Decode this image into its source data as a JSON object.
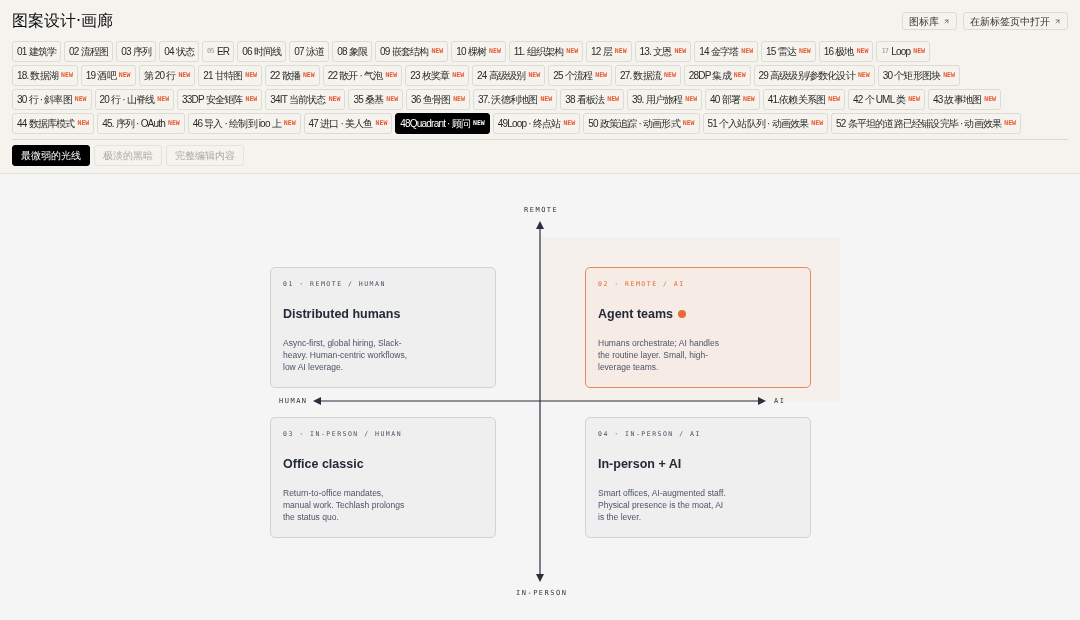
{
  "title": "图案设计·画廊",
  "header_links": [
    {
      "label": "图标库"
    },
    {
      "label": "在新标签页中打开"
    }
  ],
  "tab_rows": [
    [
      {
        "label": "01 建筑学",
        "selected": false
      },
      {
        "label": "02 流程图",
        "selected": false
      },
      {
        "label": "03 序列",
        "selected": false
      },
      {
        "label": "04 状态",
        "selected": false
      },
      {
        "prefix": "05",
        "label": "ER",
        "selected": false
      },
      {
        "label": "06 时间线",
        "selected": false
      },
      {
        "label": "07 泳道",
        "selected": false
      },
      {
        "label": "08 象限",
        "selected": false
      },
      {
        "label": "09 嵌套结构",
        "badge": "NEW",
        "selected": false
      },
      {
        "label": "10 棵树",
        "badge": "NEW",
        "selected": false
      },
      {
        "label": "11. 组织架构",
        "badge": "NEW",
        "selected": false
      },
      {
        "label": "12 层",
        "badge": "NEW",
        "selected": false
      },
      {
        "label": "13. 文恩",
        "badge": "NEW",
        "selected": false
      },
      {
        "label": "14 金字塔",
        "badge": "NEW",
        "selected": false
      },
      {
        "label": "15 雷达",
        "badge": "NEW",
        "selected": false
      },
      {
        "label": "16 极地",
        "badge": "NEW",
        "selected": false
      },
      {
        "prefix": "17",
        "label": "Loop",
        "badge": "NEW",
        "selected": false
      }
    ],
    [
      {
        "label": "18. 数据湖",
        "badge": "NEW",
        "selected": false
      },
      {
        "label": "19 酒吧",
        "badge": "NEW",
        "selected": false
      },
      {
        "label": "第 20 行",
        "badge": "NEW",
        "selected": false
      },
      {
        "label": "21 甘特图",
        "badge": "NEW",
        "selected": false
      },
      {
        "label": "22 散播",
        "badge": "NEW",
        "selected": false
      },
      {
        "label": "22 散开 · 气泡",
        "badge": "NEW",
        "selected": false
      },
      {
        "label": "23 枚奖章",
        "badge": "NEW",
        "selected": false
      },
      {
        "label": "24 高级级别",
        "badge": "NEW",
        "selected": false
      },
      {
        "label": "25 个流程",
        "badge": "NEW",
        "selected": false
      },
      {
        "label": "27. 数据流",
        "badge": "NEW",
        "selected": false
      },
      {
        "label": "28DP 集成",
        "badge": "NEW",
        "selected": false
      },
      {
        "label": "29 高级级别/参数化设计",
        "badge": "NEW",
        "selected": false
      },
      {
        "label": "30 个矩形图块",
        "badge": "NEW",
        "selected": false
      }
    ],
    [
      {
        "label": "30 行 · 斜率图",
        "badge": "NEW",
        "selected": false
      },
      {
        "label": "20 行 · 山脊线",
        "badge": "NEW",
        "selected": false
      },
      {
        "label": "33DP 安全矩阵",
        "badge": "NEW",
        "selected": false
      },
      {
        "label": "34IT 当前状态",
        "badge": "NEW",
        "selected": false
      },
      {
        "label": "35 桑基",
        "badge": "NEW",
        "selected": false
      },
      {
        "label": "36 鱼骨图",
        "badge": "NEW",
        "selected": false
      },
      {
        "label": "37. 沃德利地图",
        "badge": "NEW",
        "selected": false
      },
      {
        "label": "38 看板法",
        "badge": "NEW",
        "selected": false
      },
      {
        "label": "39. 用户旅程",
        "badge": "NEW",
        "selected": false
      },
      {
        "label": "40 部署",
        "badge": "NEW",
        "selected": false
      },
      {
        "label": "41.依赖关系图",
        "badge": "NEW",
        "selected": false
      },
      {
        "label": "42 个 UML 类",
        "badge": "NEW",
        "selected": false
      },
      {
        "label": "43 故事地图",
        "badge": "NEW",
        "selected": false
      }
    ],
    [
      {
        "label": "44 数据库模式",
        "badge": "NEW",
        "selected": false
      },
      {
        "label": "45. 序列 · OAuth",
        "badge": "NEW",
        "selected": false
      },
      {
        "label": "46 导入 · 绘制到 ioo 上",
        "badge": "NEW",
        "selected": false
      },
      {
        "label": "47 进口 · 美人鱼",
        "badge": "NEW",
        "selected": false
      },
      {
        "label": "48Quadrant · 顾问",
        "badge": "NEW",
        "selected": true
      },
      {
        "label": "49Loop · 终点站",
        "badge": "NEW",
        "selected": false
      },
      {
        "label": "50 政策追踪 · 动画形式",
        "badge": "NEW",
        "selected": false
      },
      {
        "label": "51 个入站队列 · 动画效果",
        "badge": "NEW",
        "selected": false
      },
      {
        "label": "52 条平坦的道路已经铺设完毕 · 动画效果",
        "badge": "NEW",
        "selected": false
      }
    ]
  ],
  "modes": [
    {
      "label": "最微弱的光线",
      "selected": true
    },
    {
      "label": "极淡的黑暗",
      "selected": false
    },
    {
      "label": "完整编辑内容",
      "selected": false
    }
  ],
  "quadrant": {
    "axes": {
      "top": "REMOTE",
      "bottom": "IN-PERSON",
      "left": "HUMAN",
      "right": "AI"
    },
    "cards": [
      {
        "tag": "01 · REMOTE / HUMAN",
        "title": "Distributed humans",
        "body": "Async-first, global hiring, Slack-heavy. Human-centric workflows, low AI leverage.",
        "highlighted": false
      },
      {
        "tag": "02 · REMOTE / AI",
        "title": "Agent teams",
        "body": "Humans orchestrate; AI handles the routine layer. Small, high-leverage teams.",
        "highlighted": true
      },
      {
        "tag": "03 · IN-PERSON / HUMAN",
        "title": "Office classic",
        "body": "Return-to-office mandates, manual work. Techlash prolongs the status quo.",
        "highlighted": false
      },
      {
        "tag": "04 · IN-PERSON / AI",
        "title": "In-person + AI",
        "body": "Smart offices, AI-augmented staff. Physical presence is the moat, AI is the lever.",
        "highlighted": false
      }
    ]
  }
}
